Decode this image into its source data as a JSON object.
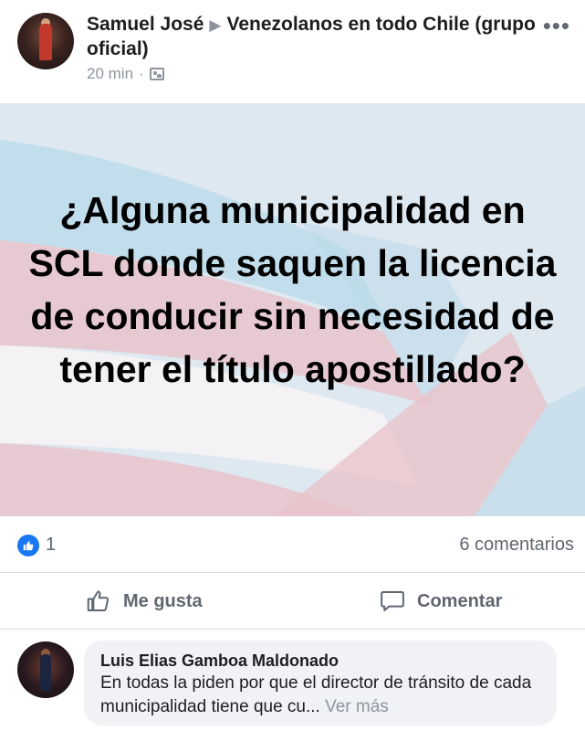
{
  "post": {
    "author": "Samuel José",
    "group": "Venezolanos en todo Chile (grupo oficial)",
    "time": "20 min",
    "separator": "·",
    "more_label": "•••",
    "image_text": "¿Alguna municipalidad en SCL donde saquen la licencia de conducir sin necesidad de tener el título apostillado?"
  },
  "reactions": {
    "count": "1",
    "comments": "6 comentarios"
  },
  "actions": {
    "like": "Me gusta",
    "comment": "Comentar"
  },
  "comment": {
    "author": "Luis Elias Gamboa Maldonado",
    "text": "En todas la piden por que el director de tránsito de cada municipalidad tiene que cu...",
    "see_more": "Ver más"
  },
  "colors": {
    "brand": "#1877f2",
    "muted": "#606770",
    "image_bg": "#dde8f0",
    "flag_pink": "#e9c3cb",
    "flag_blue": "#bcd9ea"
  },
  "icons": {
    "like_badge": "thumbs-up-icon",
    "group_privacy": "group-icon",
    "like_action": "thumbs-up-outline-icon",
    "comment_action": "speech-bubble-icon"
  }
}
